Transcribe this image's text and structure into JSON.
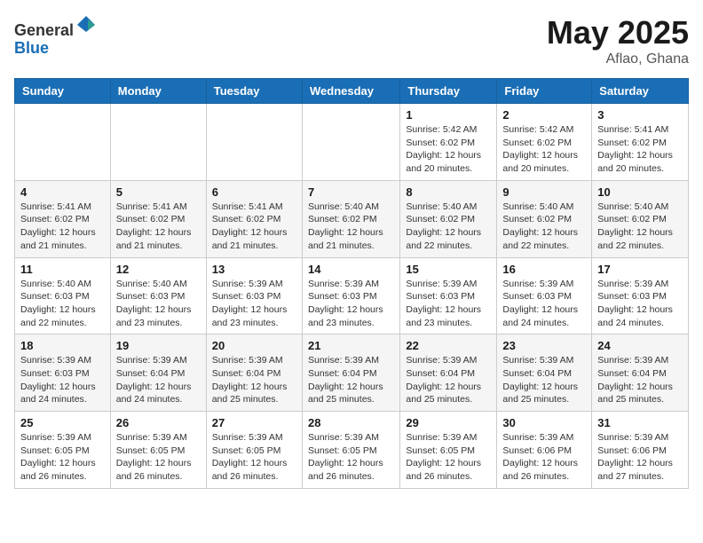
{
  "header": {
    "logo_general": "General",
    "logo_blue": "Blue",
    "title": "May 2025",
    "location": "Aflao, Ghana"
  },
  "weekdays": [
    "Sunday",
    "Monday",
    "Tuesday",
    "Wednesday",
    "Thursday",
    "Friday",
    "Saturday"
  ],
  "weeks": [
    [
      {
        "day": "",
        "info": ""
      },
      {
        "day": "",
        "info": ""
      },
      {
        "day": "",
        "info": ""
      },
      {
        "day": "",
        "info": ""
      },
      {
        "day": "1",
        "info": "Sunrise: 5:42 AM\nSunset: 6:02 PM\nDaylight: 12 hours\nand 20 minutes."
      },
      {
        "day": "2",
        "info": "Sunrise: 5:42 AM\nSunset: 6:02 PM\nDaylight: 12 hours\nand 20 minutes."
      },
      {
        "day": "3",
        "info": "Sunrise: 5:41 AM\nSunset: 6:02 PM\nDaylight: 12 hours\nand 20 minutes."
      }
    ],
    [
      {
        "day": "4",
        "info": "Sunrise: 5:41 AM\nSunset: 6:02 PM\nDaylight: 12 hours\nand 21 minutes."
      },
      {
        "day": "5",
        "info": "Sunrise: 5:41 AM\nSunset: 6:02 PM\nDaylight: 12 hours\nand 21 minutes."
      },
      {
        "day": "6",
        "info": "Sunrise: 5:41 AM\nSunset: 6:02 PM\nDaylight: 12 hours\nand 21 minutes."
      },
      {
        "day": "7",
        "info": "Sunrise: 5:40 AM\nSunset: 6:02 PM\nDaylight: 12 hours\nand 21 minutes."
      },
      {
        "day": "8",
        "info": "Sunrise: 5:40 AM\nSunset: 6:02 PM\nDaylight: 12 hours\nand 22 minutes."
      },
      {
        "day": "9",
        "info": "Sunrise: 5:40 AM\nSunset: 6:02 PM\nDaylight: 12 hours\nand 22 minutes."
      },
      {
        "day": "10",
        "info": "Sunrise: 5:40 AM\nSunset: 6:02 PM\nDaylight: 12 hours\nand 22 minutes."
      }
    ],
    [
      {
        "day": "11",
        "info": "Sunrise: 5:40 AM\nSunset: 6:03 PM\nDaylight: 12 hours\nand 22 minutes."
      },
      {
        "day": "12",
        "info": "Sunrise: 5:40 AM\nSunset: 6:03 PM\nDaylight: 12 hours\nand 23 minutes."
      },
      {
        "day": "13",
        "info": "Sunrise: 5:39 AM\nSunset: 6:03 PM\nDaylight: 12 hours\nand 23 minutes."
      },
      {
        "day": "14",
        "info": "Sunrise: 5:39 AM\nSunset: 6:03 PM\nDaylight: 12 hours\nand 23 minutes."
      },
      {
        "day": "15",
        "info": "Sunrise: 5:39 AM\nSunset: 6:03 PM\nDaylight: 12 hours\nand 23 minutes."
      },
      {
        "day": "16",
        "info": "Sunrise: 5:39 AM\nSunset: 6:03 PM\nDaylight: 12 hours\nand 24 minutes."
      },
      {
        "day": "17",
        "info": "Sunrise: 5:39 AM\nSunset: 6:03 PM\nDaylight: 12 hours\nand 24 minutes."
      }
    ],
    [
      {
        "day": "18",
        "info": "Sunrise: 5:39 AM\nSunset: 6:03 PM\nDaylight: 12 hours\nand 24 minutes."
      },
      {
        "day": "19",
        "info": "Sunrise: 5:39 AM\nSunset: 6:04 PM\nDaylight: 12 hours\nand 24 minutes."
      },
      {
        "day": "20",
        "info": "Sunrise: 5:39 AM\nSunset: 6:04 PM\nDaylight: 12 hours\nand 25 minutes."
      },
      {
        "day": "21",
        "info": "Sunrise: 5:39 AM\nSunset: 6:04 PM\nDaylight: 12 hours\nand 25 minutes."
      },
      {
        "day": "22",
        "info": "Sunrise: 5:39 AM\nSunset: 6:04 PM\nDaylight: 12 hours\nand 25 minutes."
      },
      {
        "day": "23",
        "info": "Sunrise: 5:39 AM\nSunset: 6:04 PM\nDaylight: 12 hours\nand 25 minutes."
      },
      {
        "day": "24",
        "info": "Sunrise: 5:39 AM\nSunset: 6:04 PM\nDaylight: 12 hours\nand 25 minutes."
      }
    ],
    [
      {
        "day": "25",
        "info": "Sunrise: 5:39 AM\nSunset: 6:05 PM\nDaylight: 12 hours\nand 26 minutes."
      },
      {
        "day": "26",
        "info": "Sunrise: 5:39 AM\nSunset: 6:05 PM\nDaylight: 12 hours\nand 26 minutes."
      },
      {
        "day": "27",
        "info": "Sunrise: 5:39 AM\nSunset: 6:05 PM\nDaylight: 12 hours\nand 26 minutes."
      },
      {
        "day": "28",
        "info": "Sunrise: 5:39 AM\nSunset: 6:05 PM\nDaylight: 12 hours\nand 26 minutes."
      },
      {
        "day": "29",
        "info": "Sunrise: 5:39 AM\nSunset: 6:05 PM\nDaylight: 12 hours\nand 26 minutes."
      },
      {
        "day": "30",
        "info": "Sunrise: 5:39 AM\nSunset: 6:06 PM\nDaylight: 12 hours\nand 26 minutes."
      },
      {
        "day": "31",
        "info": "Sunrise: 5:39 AM\nSunset: 6:06 PM\nDaylight: 12 hours\nand 27 minutes."
      }
    ]
  ]
}
